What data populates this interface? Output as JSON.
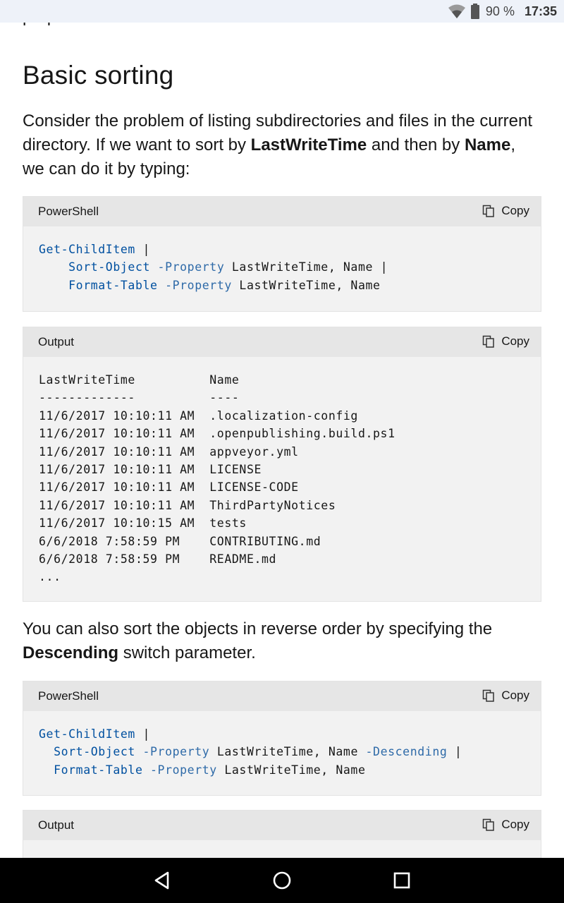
{
  "status_bar": {
    "battery_percent": "90 %",
    "time": "17:35"
  },
  "cut_off_text": "properties.",
  "heading": "Basic sorting",
  "para1": {
    "t1": "Consider the problem of listing subdirectories and files in the current directory. If we want to sort by ",
    "b1": "LastWriteTime",
    "t2": " and then by ",
    "b2": "Name",
    "t3": ", we can do it by typing:"
  },
  "code1": {
    "lang": "PowerShell",
    "copy_label": "Copy",
    "line1_cmd": "Get-ChildItem",
    "line1_rest": " |",
    "line2_indent": "    ",
    "line2_cmd": "Sort-Object",
    "line2_param": " -Property",
    "line2_rest": " LastWriteTime, Name |",
    "line3_indent": "    ",
    "line3_cmd": "Format-Table",
    "line3_param": " -Property",
    "line3_rest": " LastWriteTime, Name"
  },
  "output1": {
    "lang": "Output",
    "copy_label": "Copy",
    "text": "LastWriteTime          Name\n-------------          ----\n11/6/2017 10:10:11 AM  .localization-config\n11/6/2017 10:10:11 AM  .openpublishing.build.ps1\n11/6/2017 10:10:11 AM  appveyor.yml\n11/6/2017 10:10:11 AM  LICENSE\n11/6/2017 10:10:11 AM  LICENSE-CODE\n11/6/2017 10:10:11 AM  ThirdPartyNotices\n11/6/2017 10:10:15 AM  tests\n6/6/2018 7:58:59 PM    CONTRIBUTING.md\n6/6/2018 7:58:59 PM    README.md\n..."
  },
  "para2": {
    "t1": "You can also sort the objects in reverse order by specifying the ",
    "b1": "Descending",
    "t2": " switch parameter."
  },
  "code2": {
    "lang": "PowerShell",
    "copy_label": "Copy",
    "line1_cmd": "Get-ChildItem",
    "line1_rest": " |",
    "line2_indent": "  ",
    "line2_cmd": "Sort-Object",
    "line2_param": " -Property",
    "line2_rest": " LastWriteTime, Name",
    "line2_param2": " -Descending",
    "line2_rest2": " |",
    "line3_indent": "  ",
    "line3_cmd": "Format-Table",
    "line3_param": " -Property",
    "line3_rest": " LastWriteTime, Name"
  },
  "output2": {
    "lang": "Output",
    "copy_label": "Copy"
  },
  "colors": {
    "keyword": "#0050a0",
    "code_bg": "#f2f2f2",
    "code_header_bg": "#e6e6e6"
  }
}
